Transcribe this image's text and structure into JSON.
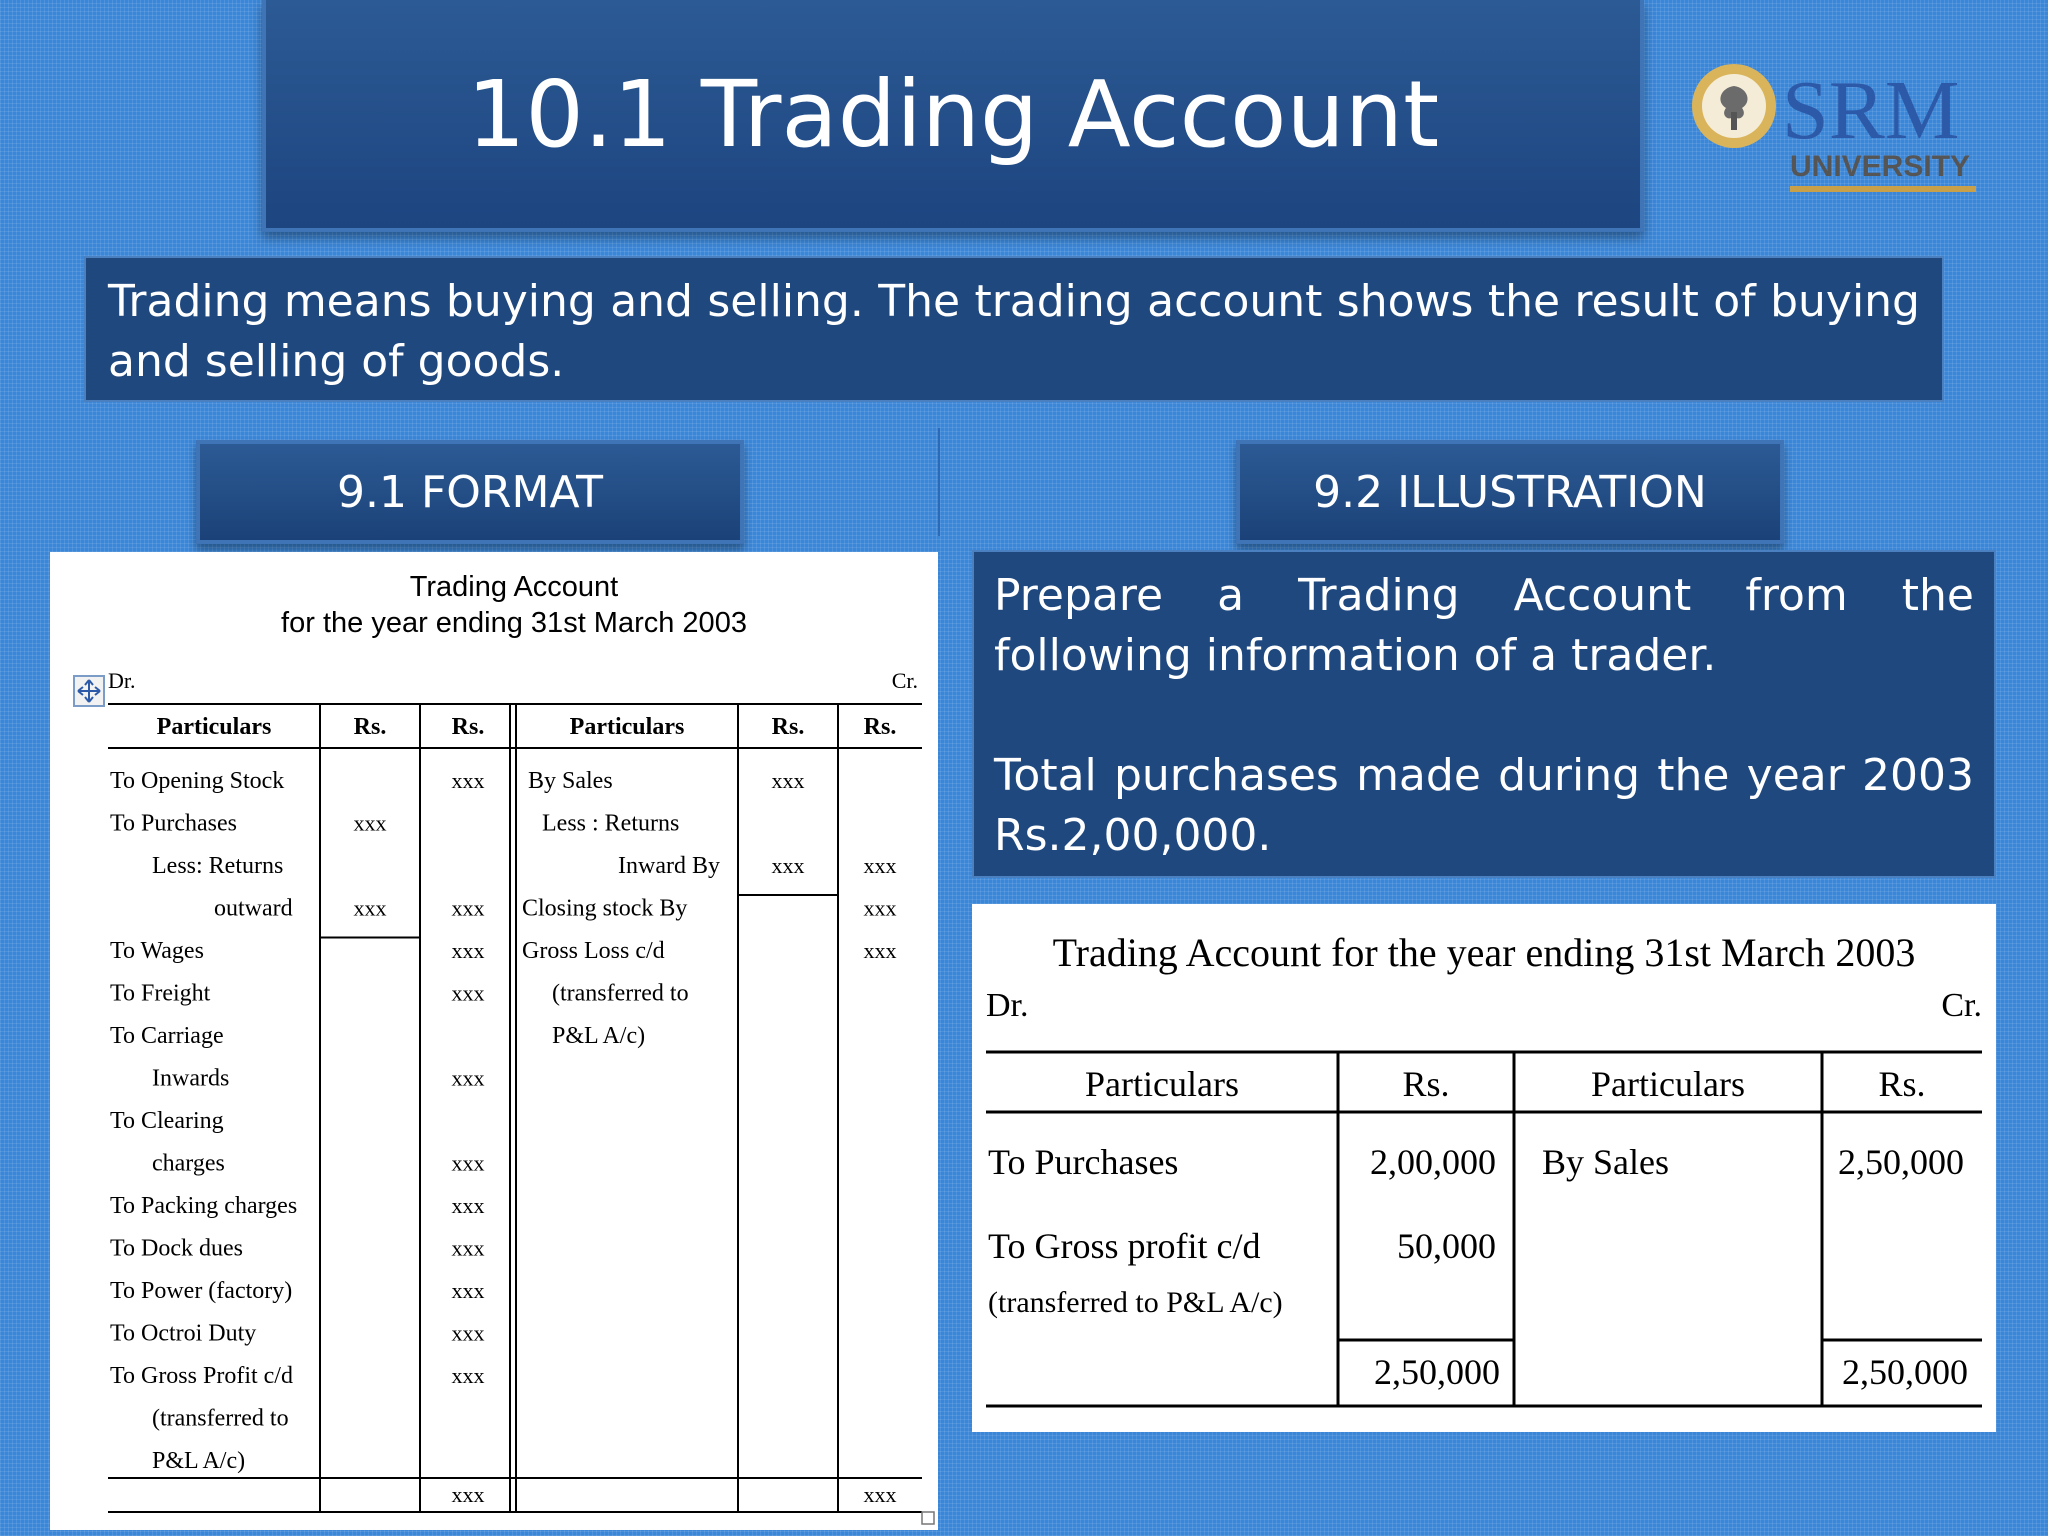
{
  "slide": {
    "title": "10.1 Trading Account",
    "logo": {
      "name": "SRM",
      "sub": "UNIVERSITY"
    },
    "intro": "Trading means buying and selling. The trading account shows the result of buying and selling of goods."
  },
  "sections": {
    "format_label": "9.1 FORMAT",
    "illustration_label": "9.2 ILLUSTRATION"
  },
  "format_table": {
    "title": "Trading Account",
    "subtitle": "for the year ending 31st March 2003",
    "dr": "Dr.",
    "cr": "Cr.",
    "headers": [
      "Particulars",
      "Rs.",
      "Rs.",
      "Particulars",
      "Rs.",
      "Rs."
    ],
    "left_rows": [
      {
        "text": "To  Opening Stock",
        "rs1": "",
        "rs2": "xxx"
      },
      {
        "text": "To   Purchases",
        "rs1": "xxx",
        "rs2": ""
      },
      {
        "text": "Less: Returns",
        "rs1": "",
        "rs2": ""
      },
      {
        "text": "outward",
        "rs1": "xxx",
        "rs2": "xxx"
      },
      {
        "text": "To      Wages",
        "rs1": "",
        "rs2": "xxx"
      },
      {
        "text": "To    Freight",
        "rs1": "",
        "rs2": "xxx"
      },
      {
        "text": "To Carriage",
        "rs1": "",
        "rs2": ""
      },
      {
        "text": "Inwards",
        "rs1": "",
        "rs2": "xxx"
      },
      {
        "text": "To  Clearing",
        "rs1": "",
        "rs2": ""
      },
      {
        "text": "charges",
        "rs1": "",
        "rs2": "xxx"
      },
      {
        "text": "To Packing charges",
        "rs1": "",
        "rs2": "xxx"
      },
      {
        "text": "To Dock dues",
        "rs1": "",
        "rs2": "xxx"
      },
      {
        "text": "To Power (factory)",
        "rs1": "",
        "rs2": "xxx"
      },
      {
        "text": "To Octroi Duty",
        "rs1": "",
        "rs2": "xxx"
      },
      {
        "text": "To Gross Profit c/d",
        "rs1": "",
        "rs2": "xxx"
      },
      {
        "text": "(transferred  to",
        "rs1": "",
        "rs2": ""
      },
      {
        "text": "P&L A/c)",
        "rs1": "",
        "rs2": ""
      }
    ],
    "right_rows": [
      {
        "text": "By Sales",
        "rs1": "xxx",
        "rs2": ""
      },
      {
        "text": "Less : Returns",
        "rs1": "",
        "rs2": ""
      },
      {
        "text": "Inward By",
        "rs1": "xxx",
        "rs2": "xxx"
      },
      {
        "text": "Closing stock By",
        "rs1": "",
        "rs2": "xxx"
      },
      {
        "text": "Gross Loss c/d",
        "rs1": "",
        "rs2": "xxx"
      },
      {
        "text": "(transferred  to",
        "rs1": "",
        "rs2": ""
      },
      {
        "text": "P&L A/c)",
        "rs1": "",
        "rs2": ""
      }
    ],
    "totals": {
      "left": "xxx",
      "right": "xxx"
    }
  },
  "illustration": {
    "prompt": "Prepare a Trading Account from the following information of a trader.",
    "given": "Total purchases made during the year 2003 Rs.2,00,000.",
    "table": {
      "title": "Trading Account for the year ending 31st March 2003",
      "dr": "Dr.",
      "cr": "Cr.",
      "headers": [
        "Particulars",
        "Rs.",
        "Particulars",
        "Rs."
      ],
      "left_rows": [
        {
          "text": "To Purchases",
          "rs": "2,00,000"
        },
        {
          "text": "To Gross profit c/d",
          "rs": "50,000"
        },
        {
          "text": "(transferred  to P&L A/c)",
          "rs": ""
        }
      ],
      "right_rows": [
        {
          "text": "By Sales",
          "rs": "2,50,000"
        }
      ],
      "totals": {
        "left": "2,50,000",
        "right": "2,50,000"
      }
    }
  }
}
